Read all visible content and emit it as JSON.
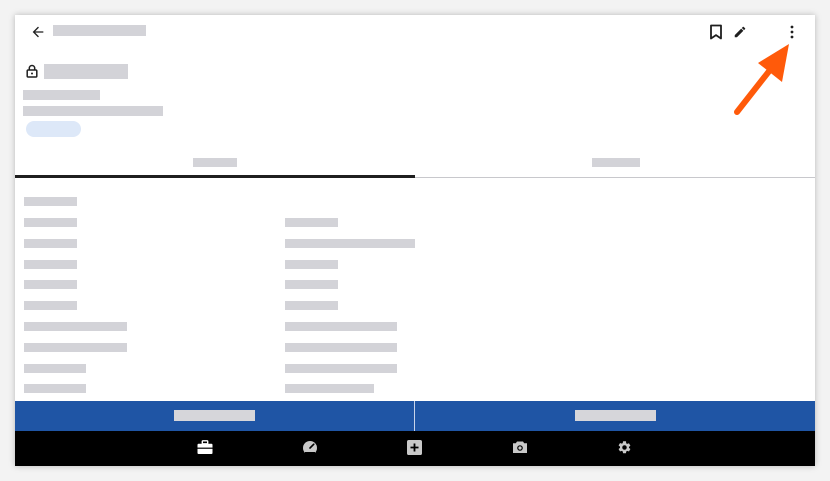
{
  "header": {
    "back_icon": "arrow-left-icon",
    "bookmark_icon": "bookmark-icon",
    "edit_icon": "pencil-icon",
    "more_icon": "more-vertical-icon"
  },
  "record": {
    "lock_icon": "lock-icon"
  },
  "bottom_nav": {
    "items": [
      "briefcase-icon",
      "speedometer-icon",
      "plus-square-icon",
      "camera-icon",
      "gear-icon"
    ]
  },
  "colors": {
    "action_bar": "#1f55a5",
    "bottom_nav": "#000000",
    "placeholder": "#d3d3d8",
    "chip": "#dde8f8",
    "annotation_arrow": "#ff5a0a"
  }
}
